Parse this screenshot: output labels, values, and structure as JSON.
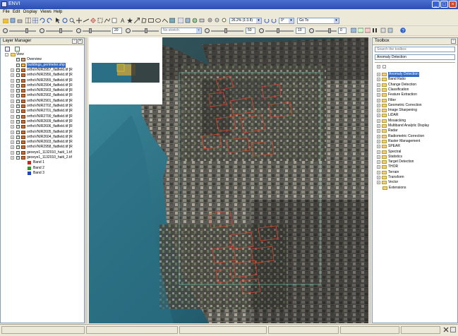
{
  "window": {
    "title": "ENVI"
  },
  "menu": [
    "File",
    "Edit",
    "Display",
    "Views",
    "Help"
  ],
  "toolbar": {
    "zoom_value": "26.2% (1:3.8)",
    "rotation_value": "0°",
    "goto_label": "Go To",
    "opacity_a": "20",
    "opacity_b": "50",
    "sharpen_value": "10",
    "no_stretch": "No stretch",
    "trans_value": "0"
  },
  "layer_manager": {
    "title": "Layer Manager",
    "root": "View",
    "overview": "Overview",
    "items": [
      "buildings_perimeter.shp",
      "orthoVNIR2957_flatfield.tif [R",
      "orthoVNIR2956_flatfield.tif [R",
      "orthoVNIR2955_flatfield.tif [R",
      "orthoVNIR2904_flatfield.tif [R",
      "orthoVNIR2903_flatfield.tif [R",
      "orthoVNIR2902_flatfield.tif [R",
      "orthoVNIR2901_flatfield.tif [R",
      "orthoVNIR2702_flatfield.tif [R",
      "orthoVNIR2701_flatfield.tif [R",
      "orthoVNIR2700_flatfield.tif [R",
      "orthoVNIR2609_flatfield.tif [R",
      "orthoVNIR2606_flatfield.tif [R",
      "orthoVNIR2605_flatfield.tif [R",
      "orthoVNIR2604_flatfield.tif [R",
      "orthoVNIR2603_flatfield.tif [R",
      "orthoVNIR2958_flatfield.tif [R",
      "geoeye1_1132010_haiti_1.tif",
      "geoeye1_1132010_haiti_2.tif"
    ],
    "bands": [
      "Band 1",
      "Band 2",
      "Band 3"
    ],
    "band_colors": [
      "#d02020",
      "#20a020",
      "#2040d0"
    ]
  },
  "toolbox": {
    "title": "Toolbox",
    "search_placeholder": "Search the toolbox",
    "search_value": "Anomaly Detection",
    "items": [
      "Anomaly Detection",
      "Band Ratio",
      "Change Detection",
      "Classification",
      "Feature Extraction",
      "Filter",
      "Geometric Correction",
      "Image Sharpening",
      "LiDAR",
      "Mosaicking",
      "Multiband Analytic Display",
      "Radar",
      "Radiometric Correction",
      "Raster Management",
      "SPEAR",
      "Spectral",
      "Statistics",
      "Target Detection",
      "THOR",
      "Terrain",
      "Transform",
      "Vector",
      "Extensions"
    ]
  },
  "colors": {
    "accent": "#316ac5",
    "vector": "#e0442a",
    "water": "#2b6f86"
  }
}
